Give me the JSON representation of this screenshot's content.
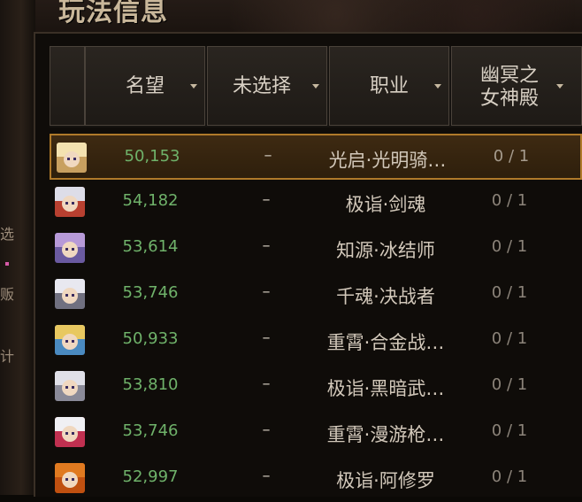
{
  "title": "玩法信息",
  "columns": [
    {
      "label": "",
      "sortable": false
    },
    {
      "label": "名望",
      "sortable": true
    },
    {
      "label": "未选择",
      "sortable": true
    },
    {
      "label": "职业",
      "sortable": true
    },
    {
      "label": "幽冥之\n女神殿",
      "sortable": true
    }
  ],
  "rows": [
    {
      "fame": "50,153",
      "unselected": "–",
      "job": "光启·光明骑…",
      "ratio": "0 / 1",
      "selected": true,
      "avatar_hair": "#f4e2b0",
      "avatar_bg": "#c8a060"
    },
    {
      "fame": "54,182",
      "unselected": "–",
      "job": "极诣·剑魂",
      "ratio": "0 / 1",
      "selected": false,
      "avatar_hair": "#dddde8",
      "avatar_bg": "#b84030"
    },
    {
      "fame": "53,614",
      "unselected": "–",
      "job": "知源·冰结师",
      "ratio": "0 / 1",
      "selected": false,
      "avatar_hair": "#b79ad8",
      "avatar_bg": "#6a5aa0"
    },
    {
      "fame": "53,746",
      "unselected": "–",
      "job": "千魂·决战者",
      "ratio": "0 / 1",
      "selected": false,
      "avatar_hair": "#e8e8f0",
      "avatar_bg": "#707080"
    },
    {
      "fame": "50,933",
      "unselected": "–",
      "job": "重霄·合金战…",
      "ratio": "0 / 1",
      "selected": false,
      "avatar_hair": "#e8c860",
      "avatar_bg": "#4a8ac0"
    },
    {
      "fame": "53,810",
      "unselected": "–",
      "job": "极诣·黑暗武…",
      "ratio": "0 / 1",
      "selected": false,
      "avatar_hair": "#e0e0e8",
      "avatar_bg": "#8a8a98"
    },
    {
      "fame": "53,746",
      "unselected": "–",
      "job": "重霄·漫游枪…",
      "ratio": "0 / 1",
      "selected": false,
      "avatar_hair": "#f0f0f4",
      "avatar_bg": "#c03050"
    },
    {
      "fame": "52,997",
      "unselected": "–",
      "job": "极诣·阿修罗",
      "ratio": "0 / 1",
      "selected": false,
      "avatar_hair": "#e07a20",
      "avatar_bg": "#c05010"
    }
  ],
  "left_glyphs": [
    "选",
    "贩",
    "计"
  ],
  "colors": {
    "fame": "#6fb26a",
    "accent": "#b07a2a"
  }
}
